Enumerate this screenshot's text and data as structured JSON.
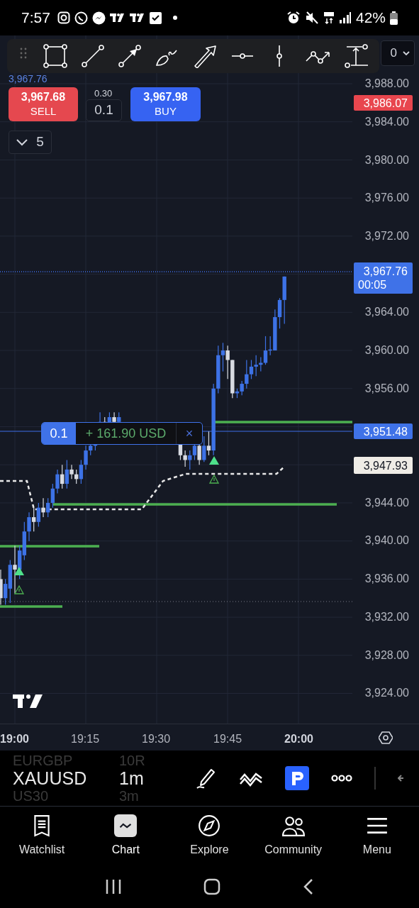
{
  "status_bar": {
    "time": "7:57",
    "battery": "42%"
  },
  "interval_dropdown": {
    "value": "0"
  },
  "chart": {
    "header_price": "3,967.76",
    "sell": {
      "price": "3,967.68",
      "label": "SELL"
    },
    "spread": "0.30",
    "quantity": "0.1",
    "buy": {
      "price": "3,967.98",
      "label": "BUY"
    },
    "indicators_toggle": {
      "count": "5"
    },
    "position": {
      "quantity": "0.1",
      "pnl": "+ 161.90 USD",
      "close": "×"
    }
  },
  "price_axis": {
    "ticks": [
      "3,988.00",
      "3,984.00",
      "3,980.00",
      "3,976.00",
      "3,972.00",
      "3,964.00",
      "3,960.00",
      "3,956.00",
      "3,944.00",
      "3,940.00",
      "3,936.00",
      "3,932.00",
      "3,928.00",
      "3,924.00"
    ],
    "badges": [
      {
        "kind": "alert",
        "label": "3,986.07"
      },
      {
        "kind": "last",
        "label": "3,967.76",
        "timer": "00:05"
      },
      {
        "kind": "position",
        "label": "3,951.48"
      },
      {
        "kind": "marker",
        "label": "3,947.93"
      }
    ]
  },
  "time_axis": {
    "labels": [
      {
        "text": "19:00",
        "bold": true
      },
      {
        "text": "19:15",
        "bold": false
      },
      {
        "text": "19:30",
        "bold": false
      },
      {
        "text": "19:45",
        "bold": false
      },
      {
        "text": "20:00",
        "bold": true
      }
    ]
  },
  "symbol_picker": {
    "symbols": [
      {
        "text": "EURGBP",
        "selected": false
      },
      {
        "text": "XAUUSD",
        "selected": true
      },
      {
        "text": "US30",
        "selected": false
      }
    ],
    "intervals": [
      {
        "text": "10R",
        "selected": false
      },
      {
        "text": "1m",
        "selected": true
      },
      {
        "text": "3m",
        "selected": false
      }
    ]
  },
  "bottom_nav": [
    {
      "label": "Watchlist",
      "selected": false
    },
    {
      "label": "Chart",
      "selected": true
    },
    {
      "label": "Explore",
      "selected": false
    },
    {
      "label": "Community",
      "selected": false
    },
    {
      "label": "Menu",
      "selected": false
    }
  ]
}
